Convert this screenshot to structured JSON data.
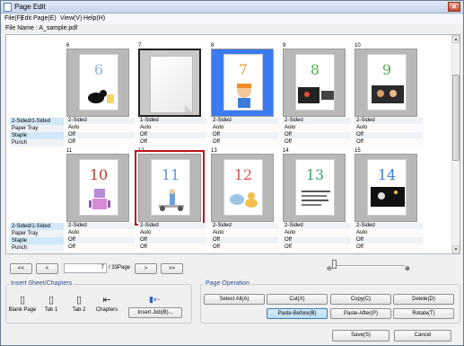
{
  "window": {
    "title": "Page Edit",
    "close_glyph": "✕"
  },
  "menu": [
    "File(F)",
    "Edit Page(E)",
    "View(V)",
    "Help(H)"
  ],
  "file_line": "File Name : A_sample.pdf",
  "row_labels": [
    "2-Sided/1-Sided",
    "Paper Tray",
    "Staple",
    "Punch"
  ],
  "pages_row1": [
    {
      "number": "6",
      "print_num": "6",
      "sides": "2-Sided",
      "tray": "Auto",
      "staple": "Off",
      "punch": "Off",
      "num_color": "#8fb3d9"
    },
    {
      "number": "7",
      "print_num": "",
      "sides": "1-Sided",
      "tray": "Auto",
      "staple": "Off",
      "punch": "Off",
      "num_color": "#000000"
    },
    {
      "number": "8",
      "print_num": "7",
      "sides": "2-Sided",
      "tray": "Auto",
      "staple": "Off",
      "punch": "Off",
      "num_color": "#e89a3c"
    },
    {
      "number": "9",
      "print_num": "8",
      "sides": "2-Sided",
      "tray": "Auto",
      "staple": "Off",
      "punch": "Off",
      "num_color": "#4caf50"
    },
    {
      "number": "10",
      "print_num": "9",
      "sides": "2-Sided",
      "tray": "Auto",
      "staple": "Off",
      "punch": "Off",
      "num_color": "#5aa85a"
    }
  ],
  "pages_row2": [
    {
      "number": "11",
      "print_num": "10",
      "sides": "2-Sided",
      "tray": "Auto",
      "staple": "Off",
      "punch": "Off",
      "num_color": "#c0392b"
    },
    {
      "number": "12",
      "print_num": "11",
      "sides": "2-Sided",
      "tray": "Auto",
      "staple": "Off",
      "punch": "Off",
      "num_color": "#5b9bd5"
    },
    {
      "number": "13",
      "print_num": "12",
      "sides": "2-Sided",
      "tray": "Auto",
      "staple": "Off",
      "punch": "Off",
      "num_color": "#d9534f"
    },
    {
      "number": "14",
      "print_num": "13",
      "sides": "2-Sided",
      "tray": "Auto",
      "staple": "Off",
      "punch": "Off",
      "num_color": "#3aa76d"
    },
    {
      "number": "15",
      "print_num": "14",
      "sides": "2-Sided",
      "tray": "Auto",
      "staple": "Off",
      "punch": "Off",
      "num_color": "#3b7dd8"
    }
  ],
  "nav": {
    "first": "<<",
    "prev": "<",
    "page_value": "7",
    "total": "/ 33Page",
    "next": ">",
    "last": ">>"
  },
  "zoom": {
    "out": "⊖",
    "in": "⊕"
  },
  "insert": {
    "title": "Insert Sheet/Chapters",
    "blank": "Blank Page",
    "tab1": "Tab 1",
    "tab2": "Tab 2",
    "chapters": "Chapters",
    "insert_job": "Insert Job(B)..."
  },
  "operation": {
    "title": "Page Operation",
    "select_all": "Select All(A)",
    "cut": "Cut(X)",
    "copy": "Copy(C)",
    "delete": "Delete(D)",
    "paste_before": "Paste-Before(B)",
    "paste_after": "Paste-After(P)",
    "rotate": "Rotate(T)"
  },
  "footer": {
    "save": "Save(S)",
    "cancel": "Cancel"
  }
}
